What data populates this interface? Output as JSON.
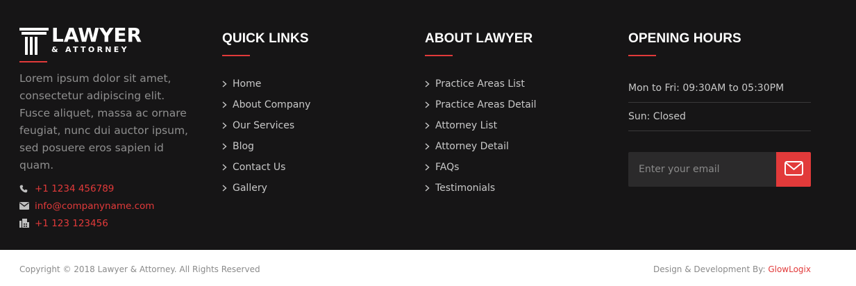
{
  "brand": {
    "title": "LAWYER",
    "subtitle": "& ATTORNEY",
    "description": "Lorem ipsum dolor sit amet, consectetur adipiscing elit. Fusce aliquet, massa ac ornare feugiat, nunc dui auctor ipsum, sed posuere eros sapien id quam.",
    "contacts": [
      {
        "icon": "phone-icon",
        "value": "+1 1234 456789"
      },
      {
        "icon": "envelope-icon",
        "value": "info@companyname.com"
      },
      {
        "icon": "fax-icon",
        "value": "+1 123 123456"
      }
    ]
  },
  "quick_links": {
    "heading": "QUICK LINKS",
    "items": [
      "Home",
      "About Company",
      "Our Services",
      "Blog",
      "Contact Us",
      "Gallery"
    ]
  },
  "about_lawyer": {
    "heading": "ABOUT LAWYER",
    "items": [
      "Practice Areas List",
      "Practice Areas Detail",
      "Attorney List",
      "Attorney Detail",
      "FAQs",
      "Testimonials"
    ]
  },
  "opening_hours": {
    "heading": "OPENING HOURS",
    "rows": [
      "Mon to Fri: 09:30AM to 05:30PM",
      "Sun: Closed"
    ],
    "email_placeholder": "Enter your email",
    "submit_icon": "mail-icon"
  },
  "bottom": {
    "copyright": "Copyright © 2018 Lawyer & Attorney. All Rights Reserved",
    "credit_prefix": "Design & Development By: ",
    "credit_link": "GlowLogix"
  },
  "colors": {
    "footer_bg": "#161516",
    "accent": "#e23a3a",
    "muted_text": "#8f8f8f",
    "link_text": "#c8c8c8",
    "input_bg": "#2b2a2b"
  }
}
